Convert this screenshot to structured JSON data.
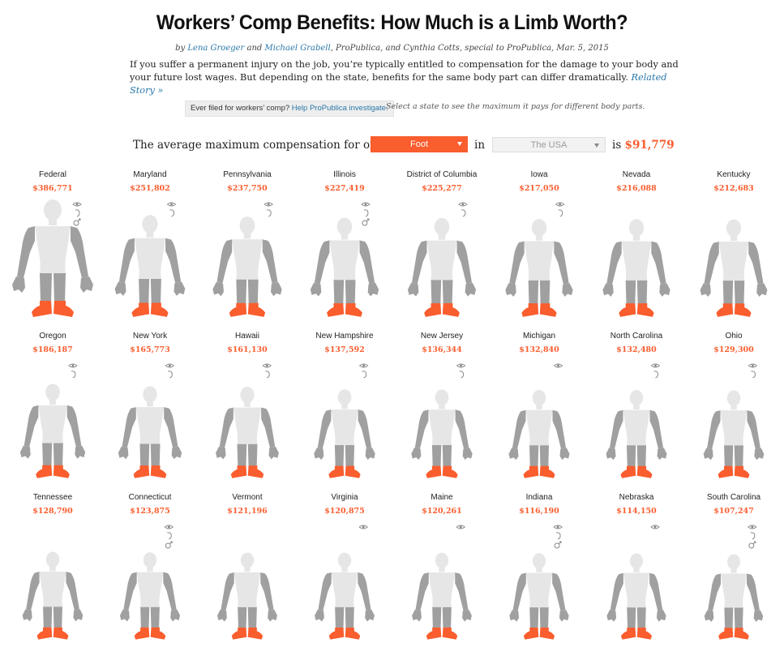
{
  "header": {
    "title": "Workers’ Comp Benefits: How Much is a Limb Worth?",
    "byline_by": "by ",
    "author1": "Lena Groeger",
    "byline_and": " and ",
    "author2": "Michael Grabell",
    "byline_rest": ", ProPublica, and Cynthia Cotts, special to ProPublica, Mar. 5, 2015",
    "intro": "If you suffer a permanent injury on the job, you’re typically entitled to compensation for the damage to your body and your future lost wages. But depending on the state, benefits for the same body part can differ dramatically. ",
    "related": "Related Story »"
  },
  "cta": {
    "prefix": "Ever filed for workers’ comp? ",
    "link": "Help ProPublica investigate.",
    "note": "Select a state to see the maximum it pays for different body parts."
  },
  "selector": {
    "lead": "The average maximum compensation for one",
    "body_part": "Foot",
    "in_word": "in",
    "state": "The USA",
    "is_word": "is",
    "amount": "$91,779"
  },
  "colors": {
    "highlight": "#fa5d2e",
    "body_fill": "#a0a0a0",
    "torso_fill": "#e6e6e6",
    "link": "#2a78a8"
  },
  "chart_data": {
    "type": "table",
    "body_part": "Foot",
    "states": [
      {
        "name": "Federal",
        "value": "$386,771",
        "amount": 386771,
        "icons": [
          "eye",
          "ear",
          "male"
        ]
      },
      {
        "name": "Maryland",
        "value": "$251,802",
        "amount": 251802,
        "icons": [
          "eye",
          "ear"
        ]
      },
      {
        "name": "Pennsylvania",
        "value": "$237,750",
        "amount": 237750,
        "icons": [
          "eye",
          "ear"
        ]
      },
      {
        "name": "Illinois",
        "value": "$227,419",
        "amount": 227419,
        "icons": [
          "eye",
          "ear",
          "male"
        ]
      },
      {
        "name": "District of Columbia",
        "value": "$225,277",
        "amount": 225277,
        "icons": [
          "eye",
          "ear"
        ]
      },
      {
        "name": "Iowa",
        "value": "$217,050",
        "amount": 217050,
        "icons": [
          "eye",
          "ear"
        ]
      },
      {
        "name": "Nevada",
        "value": "$216,088",
        "amount": 216088,
        "icons": []
      },
      {
        "name": "Kentucky",
        "value": "$212,683",
        "amount": 212683,
        "icons": []
      },
      {
        "name": "Oregon",
        "value": "$186,187",
        "amount": 186187,
        "icons": [
          "eye",
          "ear"
        ]
      },
      {
        "name": "New York",
        "value": "$165,773",
        "amount": 165773,
        "icons": [
          "eye",
          "ear"
        ]
      },
      {
        "name": "Hawaii",
        "value": "$161,130",
        "amount": 161130,
        "icons": [
          "eye",
          "ear"
        ]
      },
      {
        "name": "New Hampshire",
        "value": "$137,592",
        "amount": 137592,
        "icons": [
          "eye",
          "ear"
        ]
      },
      {
        "name": "New Jersey",
        "value": "$136,344",
        "amount": 136344,
        "icons": [
          "eye",
          "ear"
        ]
      },
      {
        "name": "Michigan",
        "value": "$132,840",
        "amount": 132840,
        "icons": [
          "eye"
        ]
      },
      {
        "name": "North Carolina",
        "value": "$132,480",
        "amount": 132480,
        "icons": [
          "eye",
          "ear"
        ]
      },
      {
        "name": "Ohio",
        "value": "$129,300",
        "amount": 129300,
        "icons": [
          "eye",
          "ear"
        ]
      },
      {
        "name": "Tennessee",
        "value": "$128,790",
        "amount": 128790,
        "icons": []
      },
      {
        "name": "Connecticut",
        "value": "$123,875",
        "amount": 123875,
        "icons": [
          "eye",
          "ear",
          "male"
        ]
      },
      {
        "name": "Vermont",
        "value": "$121,196",
        "amount": 121196,
        "icons": []
      },
      {
        "name": "Virginia",
        "value": "$120,875",
        "amount": 120875,
        "icons": [
          "eye"
        ]
      },
      {
        "name": "Maine",
        "value": "$120,261",
        "amount": 120261,
        "icons": [
          "eye"
        ]
      },
      {
        "name": "Indiana",
        "value": "$116,190",
        "amount": 116190,
        "icons": [
          "eye",
          "ear",
          "male"
        ]
      },
      {
        "name": "Nebraska",
        "value": "$114,150",
        "amount": 114150,
        "icons": [
          "eye"
        ]
      },
      {
        "name": "South Carolina",
        "value": "$107,247",
        "amount": 107247,
        "icons": [
          "eye",
          "ear",
          "male"
        ]
      }
    ]
  }
}
